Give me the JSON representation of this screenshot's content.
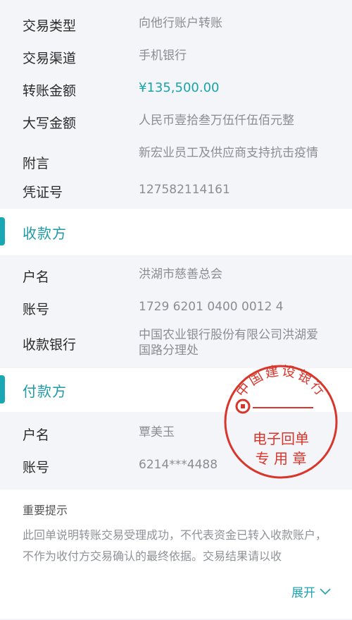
{
  "details": {
    "type_label": "交易类型",
    "type_value": "向他行账户转账",
    "channel_label": "交易渠道",
    "channel_value": "手机银行",
    "amount_label": "转账金额",
    "amount_value": "¥135,500.00",
    "caps_label": "大写金额",
    "caps_value": "人民币壹拾叁万伍仟伍佰元整",
    "note_label": "附言",
    "note_value": "新宏业员工及供应商支持抗击疫情",
    "voucher_label": "凭证号",
    "voucher_value": "127582114161"
  },
  "payee": {
    "section_title": "收款方",
    "name_label": "户名",
    "name_value": "洪湖市慈善总会",
    "account_label": "账号",
    "account_value": "1729 6201 0400 0012 4",
    "bank_label": "收款银行",
    "bank_value": "中国农业银行股份有限公司洪湖爱国路分理处"
  },
  "payer": {
    "section_title": "付款方",
    "name_label": "户名",
    "name_value": "覃美玉",
    "account_label": "账号",
    "account_value": "6214***4488"
  },
  "stamp": {
    "bank_name": "中国建设银行",
    "line1": "电子回单",
    "line2": "专 用 章"
  },
  "notice": {
    "title": "重要提示",
    "body": "此回单说明转账交易受理成功，不代表资金已转入收款账户，不作为收付方交易确认的最终依据。交易结果请以收"
  },
  "expand_label": "展开",
  "colors": {
    "accent": "#18a7b3",
    "amount": "#1aa3a8",
    "stamp_red": "#d9362b"
  }
}
